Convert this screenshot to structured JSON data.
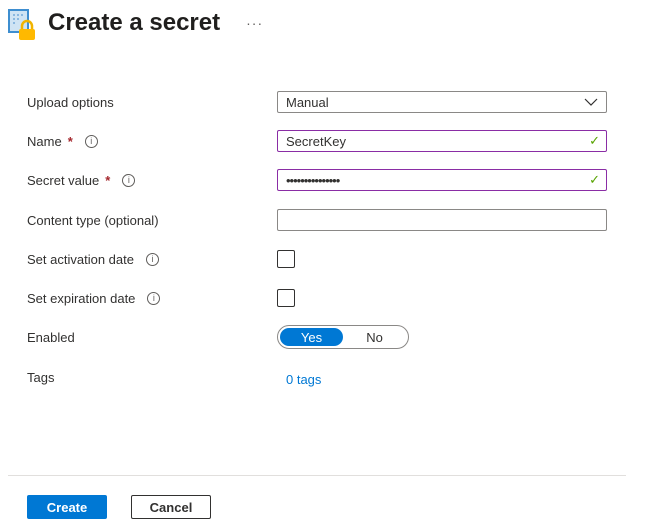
{
  "header": {
    "title": "Create a secret",
    "more": "···",
    "icon": "key-vault-lock-icon"
  },
  "fields": {
    "upload": {
      "label": "Upload options",
      "value": "Manual"
    },
    "name": {
      "label": "Name",
      "required": "*",
      "value": "SecretKey"
    },
    "secret": {
      "label": "Secret value",
      "required": "*",
      "value": "•••••••••••••••"
    },
    "content": {
      "label": "Content type (optional)",
      "value": ""
    },
    "activation": {
      "label": "Set activation date",
      "checked": false
    },
    "expiration": {
      "label": "Set expiration date",
      "checked": false
    },
    "enabled": {
      "label": "Enabled",
      "yes": "Yes",
      "no": "No",
      "selected": "Yes"
    },
    "tags": {
      "label": "Tags",
      "link": "0 tags"
    }
  },
  "footer": {
    "create": "Create",
    "cancel": "Cancel"
  },
  "colors": {
    "accent": "#0078d4",
    "valid_border": "#8a2da5",
    "check": "#57a300"
  }
}
